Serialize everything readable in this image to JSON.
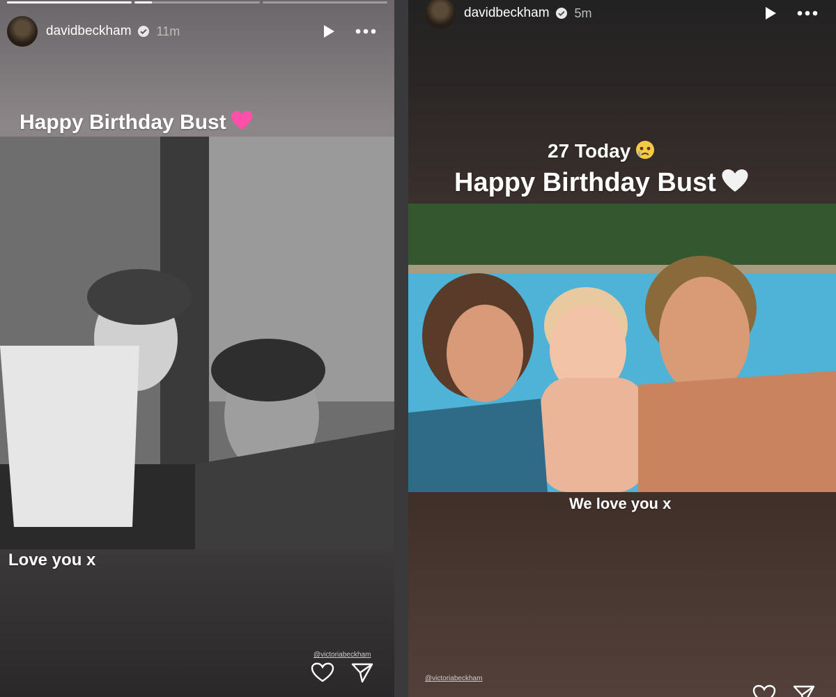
{
  "left_story": {
    "progress_segments": [
      1,
      0.14,
      0
    ],
    "username": "davidbeckham",
    "time": "11m",
    "caption_top": "Happy Birthday Bust",
    "caption_bottom": "Love you x",
    "mention": "@victoriabeckham",
    "heart_color": "#ff4fa8"
  },
  "right_story": {
    "username": "davidbeckham",
    "time": "5m",
    "caption_line1": "27 Today",
    "caption_line2": "Happy Birthday Bust",
    "caption_bottom": "We love you x",
    "mention": "@victoriabeckham",
    "heart_color": "#ffffff"
  },
  "icons": {
    "verified": "verified-badge-icon",
    "play": "play-icon",
    "more": "more-options-icon",
    "like": "heart-outline-icon",
    "share": "send-icon",
    "emoji_heart_pink": "pink-heart-emoji",
    "emoji_heart_white": "white-heart-emoji",
    "emoji_teary": "teary-face-emoji"
  }
}
